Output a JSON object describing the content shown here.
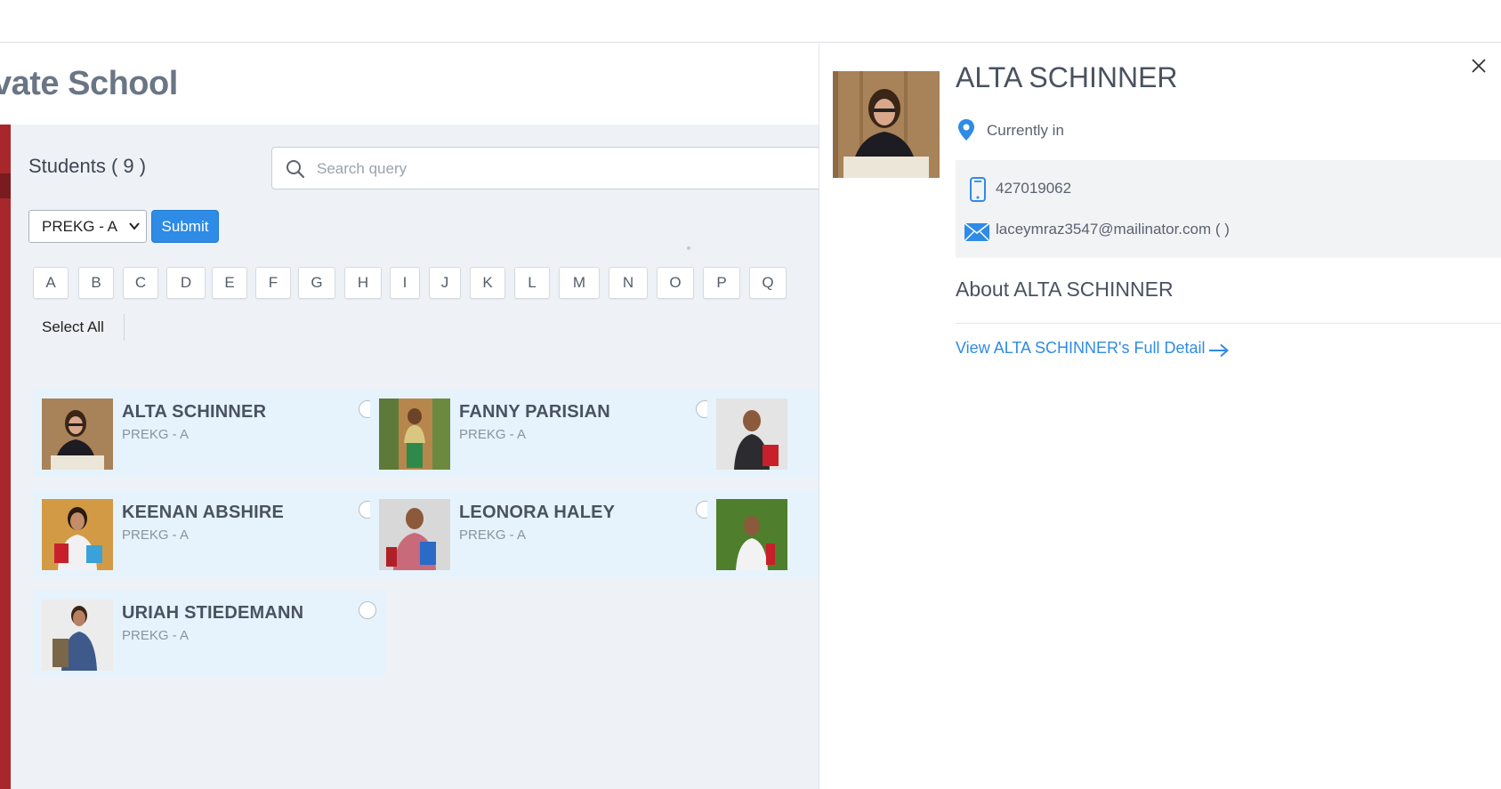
{
  "school": {
    "title": "vate School"
  },
  "students": {
    "heading": "Students ( 9 )",
    "search_placeholder": "Search query",
    "grade_selected": "PREKG - A",
    "submit_label": "Submit",
    "select_all_label": "Select All",
    "letters": [
      "A",
      "B",
      "C",
      "D",
      "E",
      "F",
      "G",
      "H",
      "I",
      "J",
      "K",
      "L",
      "M",
      "N",
      "O",
      "P",
      "Q"
    ],
    "cards": [
      {
        "name": "ALTA SCHINNER",
        "grade": "PREKG - A"
      },
      {
        "name": "FANNY PARISIAN",
        "grade": "PREKG - A"
      },
      {
        "name": "",
        "grade": ""
      },
      {
        "name": "KEENAN ABSHIRE",
        "grade": "PREKG - A"
      },
      {
        "name": "LEONORA HALEY",
        "grade": "PREKG - A"
      },
      {
        "name": "",
        "grade": ""
      },
      {
        "name": "URIAH STIEDEMANN",
        "grade": "PREKG - A"
      }
    ]
  },
  "detail": {
    "name": "ALTA SCHINNER",
    "location_text": "Currently in",
    "phone": "427019062",
    "email": "laceymraz3547@mailinator.com ( )",
    "about_heading": "About ALTA SCHINNER",
    "full_detail_link": "View ALTA SCHINNER's Full Detail"
  },
  "icons": {
    "search": "search-icon",
    "location": "map-pin-icon",
    "phone": "phone-icon",
    "email": "envelope-icon",
    "close": "close-icon",
    "arrow": "arrow-right-icon"
  },
  "colors": {
    "accent": "#2e8be6",
    "sidebar": "#a8272c",
    "card_bg": "#e6f3fc",
    "content_bg": "#eef1f5"
  }
}
